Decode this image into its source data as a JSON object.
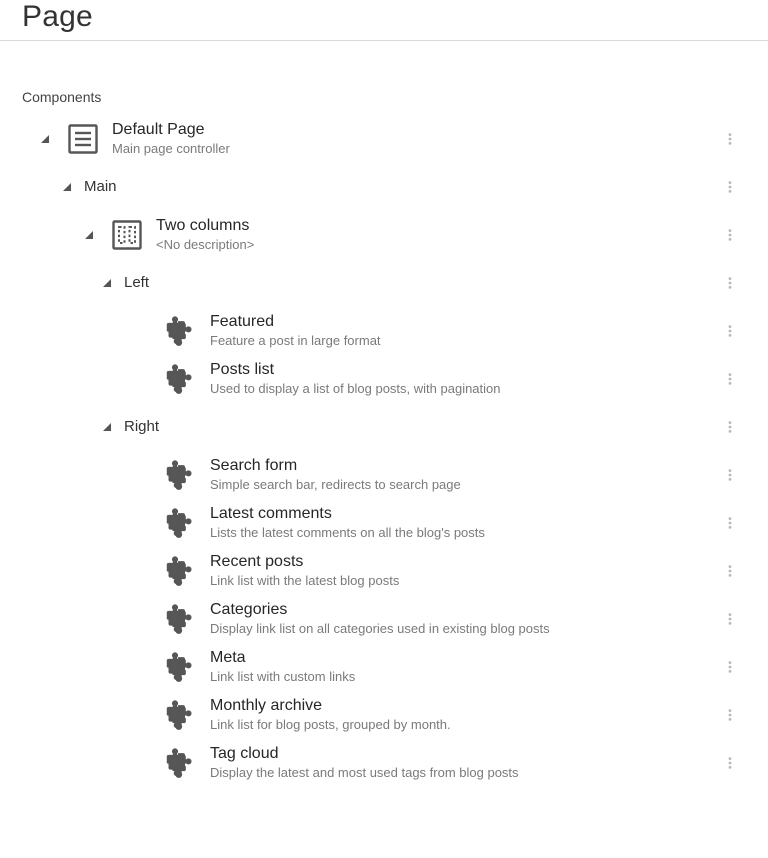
{
  "header": {
    "title": "Page"
  },
  "section_label": "Components",
  "tree": {
    "root": {
      "title": "Default Page",
      "desc": "Main page controller"
    },
    "main": {
      "label": "Main"
    },
    "two_cols": {
      "title": "Two columns",
      "desc": "<No description>"
    },
    "left": {
      "label": "Left"
    },
    "left_items": [
      {
        "title": "Featured",
        "desc": "Feature a post in large format"
      },
      {
        "title": "Posts list",
        "desc": "Used to display a list of blog posts, with pagination"
      }
    ],
    "right": {
      "label": "Right"
    },
    "right_items": [
      {
        "title": "Search form",
        "desc": "Simple search bar, redirects to search page"
      },
      {
        "title": "Latest comments",
        "desc": "Lists the latest comments on all the blog's posts"
      },
      {
        "title": "Recent posts",
        "desc": "Link list with the latest blog posts"
      },
      {
        "title": "Categories",
        "desc": "Display link list on all categories used in existing blog posts"
      },
      {
        "title": "Meta",
        "desc": "Link list with custom links"
      },
      {
        "title": "Monthly archive",
        "desc": "Link list for blog posts, grouped by month."
      },
      {
        "title": "Tag cloud",
        "desc": "Display the latest and most used tags from blog posts"
      }
    ]
  }
}
